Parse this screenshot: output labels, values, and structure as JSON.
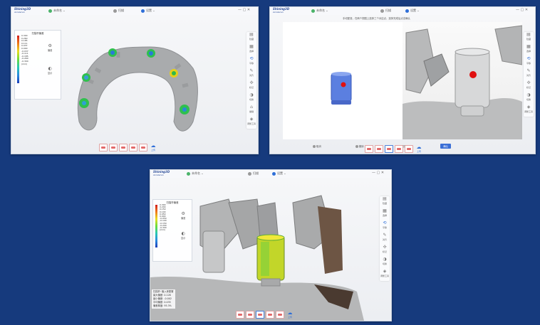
{
  "app": {
    "brand": "Shining3D",
    "brand_sub": "Aoralscan"
  },
  "window1": {
    "title_left": "未命名",
    "title_mid": "扫描",
    "title_right": "设置",
    "legend_title": "扫描杆偏差",
    "legend_ticks": [
      "0.300",
      "0.260",
      "0.185",
      "0.111",
      "0.037",
      "0.000",
      "-0.037",
      "-0.111",
      "-0.185",
      "-0.260",
      "-0.300"
    ],
    "legend_unit": "(mm)",
    "ctl_a": "偏差",
    "ctl_b": "显示",
    "sidebar": [
      "隐藏",
      "选择",
      "平移",
      "对齐",
      "标记",
      "切换",
      "撤销",
      "调整工具"
    ]
  },
  "window2": {
    "title_left": "未命名",
    "title_mid": "扫描",
    "title_right": "设置",
    "hint": "手动配准，在两个视图上选择三个对应点，选择完成后点击确认",
    "btn_cancel": "取消",
    "btn_undo": "撤销",
    "btn_reset": "重置",
    "btn_ok": "确认",
    "sidebar": [
      "隐藏",
      "选择",
      "平移",
      "对齐",
      "标记",
      "切换",
      "调整工具"
    ]
  },
  "window3": {
    "title_left": "未命名",
    "title_mid": "扫描",
    "title_right": "设置",
    "legend_title": "扫描杆偏差",
    "legend_ticks": [
      "0.300",
      "0.200",
      "0.150",
      "0.100",
      "0.050",
      "0.000",
      "-0.050",
      "-0.100",
      "-0.150",
      "-0.200",
      "-0.300"
    ],
    "legend_unit": "(mm)",
    "ctl_a": "偏差",
    "ctl_b": "显示",
    "info_lines": [
      "扫描杆: 植入体配置",
      "最大偏差: 0.126",
      "最小偏差: -0.002",
      "平均偏差: 0.035",
      "偏差覆盖: 95.3%"
    ],
    "sidebar": [
      "隐藏",
      "选择",
      "平移",
      "对齐",
      "标记",
      "切换",
      "调整工具"
    ]
  },
  "bottom": {
    "upload": "上传"
  },
  "icons": {
    "gear": "gear-icon",
    "cloud": "cloud-upload-icon",
    "eye": "eye-icon"
  },
  "colors": {
    "bg": "#163a7d",
    "accent": "#2f6fd8",
    "scanbody_blue": "#5b7fe0",
    "marker_red": "#e01010"
  }
}
